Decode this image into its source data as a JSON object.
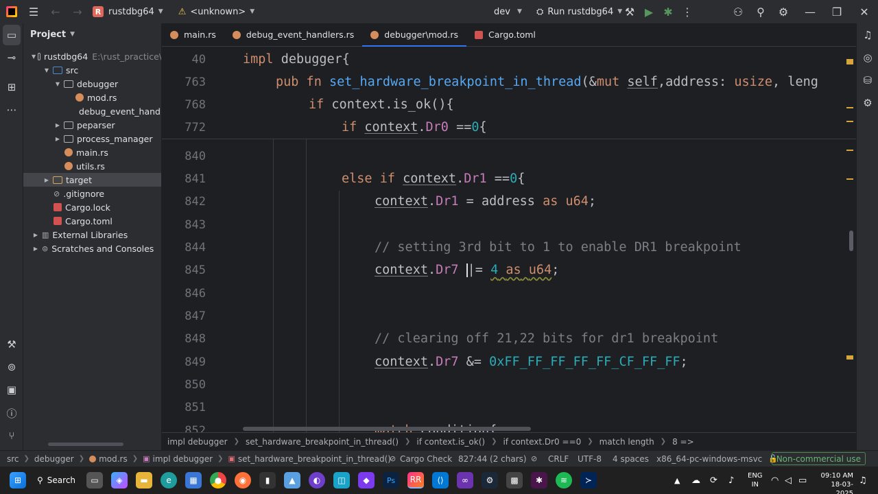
{
  "titlebar": {
    "project_initial": "R",
    "project_name": "rustdbg64",
    "config_warning": "<unknown>",
    "branch": "dev",
    "run_config": "Run rustdbg64"
  },
  "project_panel": {
    "title": "Project",
    "items": [
      {
        "label": "rustdbg64",
        "extra": "E:\\rust_practice\\"
      },
      {
        "label": "src"
      },
      {
        "label": "debugger"
      },
      {
        "label": "mod.rs"
      },
      {
        "label": "debug_event_handlers.rs"
      },
      {
        "label": "peparser"
      },
      {
        "label": "process_manager"
      },
      {
        "label": "main.rs"
      },
      {
        "label": "utils.rs"
      },
      {
        "label": "target"
      },
      {
        "label": ".gitignore"
      },
      {
        "label": "Cargo.lock"
      },
      {
        "label": "Cargo.toml"
      },
      {
        "label": "External Libraries"
      },
      {
        "label": "Scratches and Consoles"
      }
    ]
  },
  "tabs": [
    {
      "label": "main.rs"
    },
    {
      "label": "debug_event_handlers.rs"
    },
    {
      "label": "debugger\\mod.rs"
    },
    {
      "label": "Cargo.toml"
    }
  ],
  "editor": {
    "sticky": [
      {
        "ln": "40"
      },
      {
        "ln": "763"
      },
      {
        "ln": "768"
      },
      {
        "ln": "772"
      }
    ],
    "lines": [
      {
        "ln": "840"
      },
      {
        "ln": "841"
      },
      {
        "ln": "842"
      },
      {
        "ln": "843"
      },
      {
        "ln": "844"
      },
      {
        "ln": "845"
      },
      {
        "ln": "846"
      },
      {
        "ln": "847"
      },
      {
        "ln": "848"
      },
      {
        "ln": "849"
      },
      {
        "ln": "850"
      },
      {
        "ln": "851"
      },
      {
        "ln": "852"
      }
    ],
    "comment1": "// setting 3rd bit to 1 to enable DR1 breakpoint",
    "comment2": "// clearing off 21,22 bits for dr1 breakpoint",
    "hex_literal": "0xFF_FF_FF_FF_FF_CF_FF_FF",
    "fn_name": "set_hardware_breakpoint_in_thread"
  },
  "breadcrumbs": [
    "impl debugger",
    "set_hardware_breakpoint_in_thread()",
    "if context.is_ok()",
    "if context.Dr0 ==0",
    "match length",
    "8 =>"
  ],
  "status": {
    "path": [
      "src",
      "debugger",
      "mod.rs",
      "impl debugger",
      "set_hardware_breakpoint_in_thread()"
    ],
    "cargo_check": "Cargo Check",
    "position": "827:44 (2 chars)",
    "line_sep": "CRLF",
    "encoding": "UTF-8",
    "indent": "4 spaces",
    "target": "x86_64-pc-windows-msvc",
    "license": "Non-commercial use"
  },
  "taskbar": {
    "search_label": "Search",
    "lang": "ENG",
    "region": "IN",
    "time": "09:10 AM",
    "date": "18-03-2025"
  },
  "colors": {
    "accent": "#3574f0",
    "keyword": "#cf8e6d",
    "function": "#56a8f5",
    "field": "#c77dbb",
    "number": "#2aacb8",
    "comment": "#7a7e85"
  }
}
